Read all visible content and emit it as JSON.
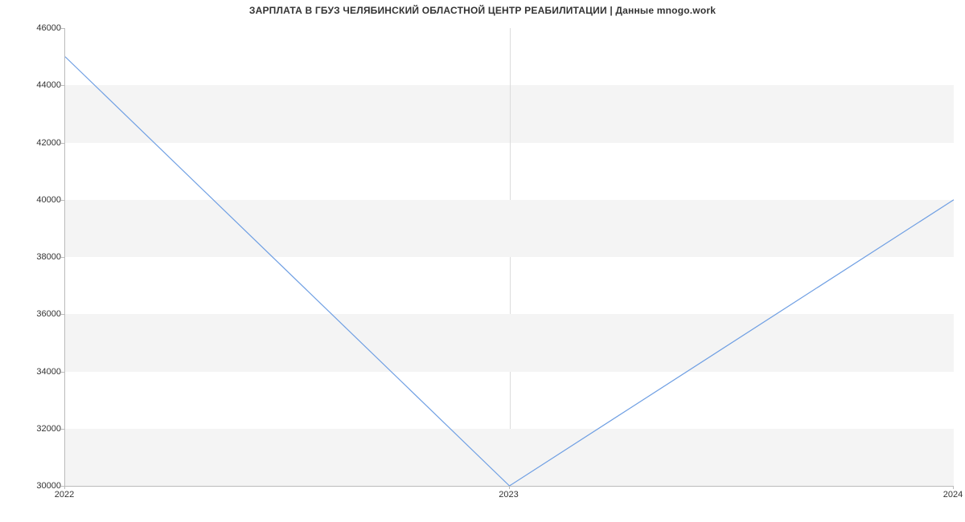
{
  "chart_data": {
    "type": "line",
    "title": "ЗАРПЛАТА В ГБУЗ ЧЕЛЯБИНСКИЙ ОБЛАСТНОЙ ЦЕНТР РЕАБИЛИТАЦИИ | Данные mnogo.work",
    "xlabel": "",
    "ylabel": "",
    "x": [
      "2022",
      "2023",
      "2024"
    ],
    "y": [
      45000,
      30000,
      40000
    ],
    "y_ticks": [
      30000,
      32000,
      34000,
      36000,
      38000,
      40000,
      42000,
      44000,
      46000
    ],
    "x_ticks": [
      "2022",
      "2023",
      "2024"
    ],
    "ylim": [
      30000,
      46000
    ],
    "line_color": "#6f9fe3",
    "band_color": "#f4f4f4"
  }
}
